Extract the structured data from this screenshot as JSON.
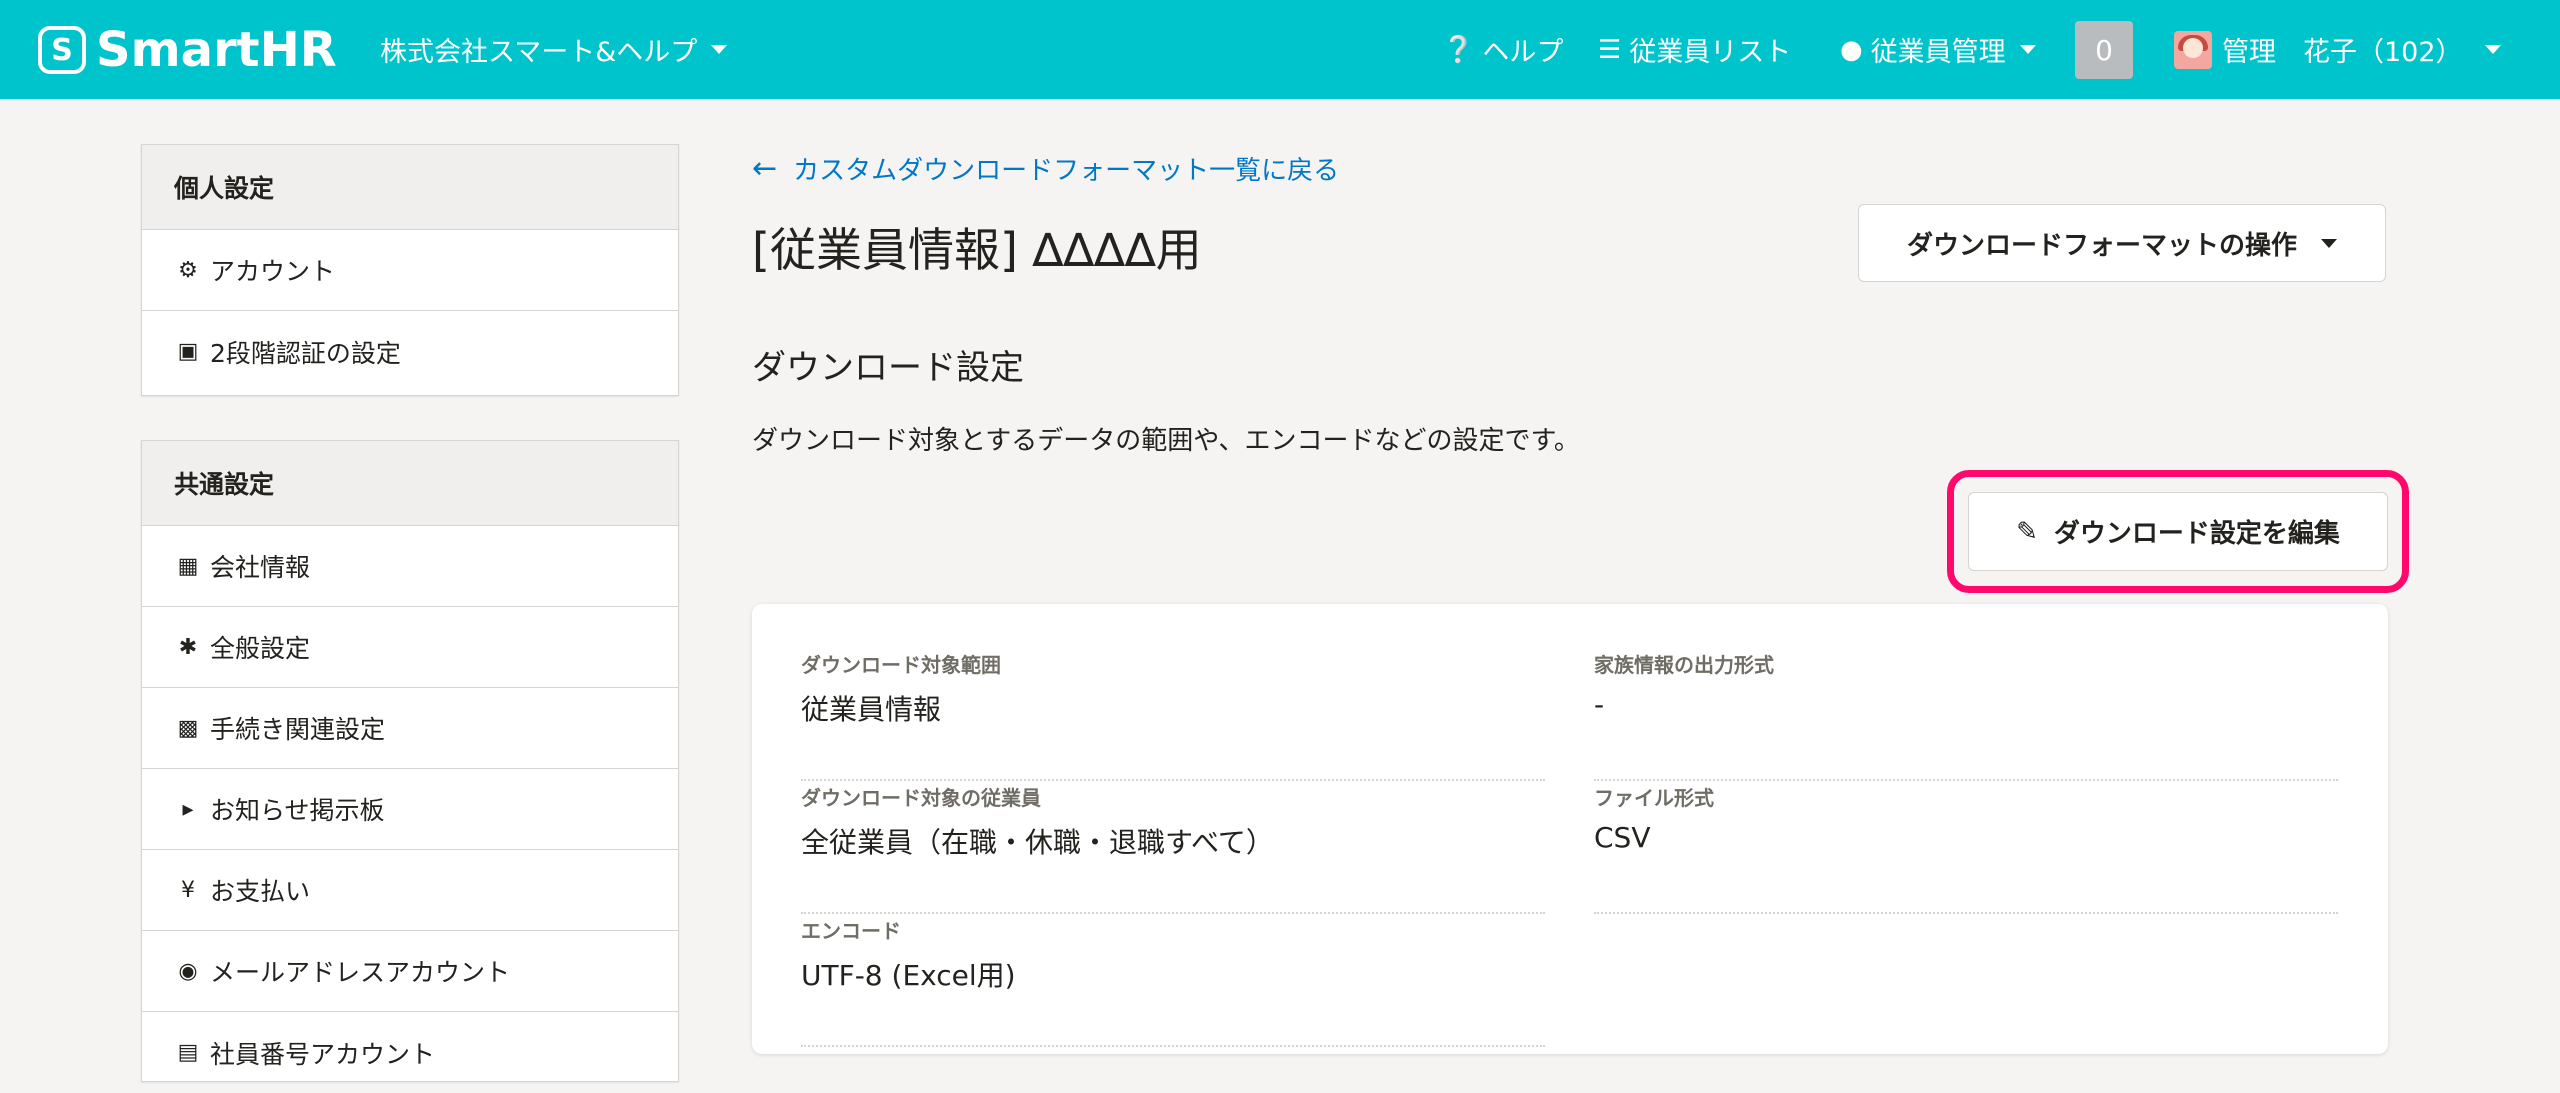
{
  "header": {
    "logo_mark": "S",
    "logo_text": "SmartHR",
    "company": "株式会社スマート&ヘルプ",
    "nav": {
      "help": "ヘルプ",
      "employee_list": "従業員リスト",
      "employee_manage": "従業員管理"
    },
    "notification_count": "0",
    "user_name": "管理　花子（102）"
  },
  "sidebar": {
    "personal": {
      "title": "個人設定",
      "items": [
        {
          "label": "アカウント",
          "icon": "gear-icon"
        },
        {
          "label": "2段階認証の設定",
          "icon": "lock-icon"
        }
      ]
    },
    "common": {
      "title": "共通設定",
      "items": [
        {
          "label": "会社情報",
          "icon": "building-icon"
        },
        {
          "label": "全般設定",
          "icon": "asterisk-icon"
        },
        {
          "label": "手続き関連設定",
          "icon": "book-icon"
        },
        {
          "label": "お知らせ掲示板",
          "icon": "megaphone-icon"
        },
        {
          "label": "お支払い",
          "icon": "yen-icon"
        },
        {
          "label": "メールアドレスアカウント",
          "icon": "users-icon"
        },
        {
          "label": "社員番号アカウント",
          "icon": "id-card-icon"
        }
      ]
    }
  },
  "main": {
    "back_link": "カスタムダウンロードフォーマット一覧に戻る",
    "title": "[従業員情報] ∆∆∆∆用",
    "ops_button": "ダウンロードフォーマットの操作",
    "section_title": "ダウンロード設定",
    "section_desc": "ダウンロード対象とするデータの範囲や、エンコードなどの設定です。",
    "edit_button": "ダウンロード設定を編集",
    "fields": [
      {
        "label": "ダウンロード対象範囲",
        "value": "従業員情報"
      },
      {
        "label": "家族情報の出力形式",
        "value": "-"
      },
      {
        "label": "ダウンロード対象の従業員",
        "value": "全従業員（在職・休職・退職すべて）"
      },
      {
        "label": "ファイル形式",
        "value": "CSV"
      },
      {
        "label": "エンコード",
        "value": "UTF-8 (Excel用)"
      }
    ]
  },
  "colors": {
    "header_bg": "#00c4cc",
    "link": "#0077c7",
    "highlight": "#ff0a6c"
  }
}
